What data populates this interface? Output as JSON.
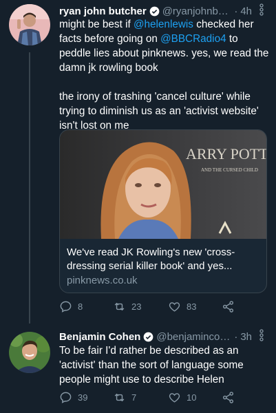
{
  "tweets": [
    {
      "name": "ryan john butcher",
      "handle": "@ryanjohnbut...",
      "time": "4h",
      "body": {
        "p1_a": "might be best if ",
        "mention1": "@helenlewis",
        "p1_b": " checked her facts before going on ",
        "mention2": "@BBCRadio4",
        "p1_c": " to peddle lies about pinknews. yes, we read the damn jk rowling book",
        "p2": "the irony of trashing 'cancel culture' while trying to diminish us as an 'activist website' isn't lost on me"
      },
      "card": {
        "image_text_line1": "ARRY POTTER",
        "image_text_line2": "AND THE CURSED CHILD",
        "title": "We've read JK Rowling's new 'cross-dressing serial killer book' and yes...",
        "domain": "pinknews.co.uk"
      },
      "actions": {
        "replies": "8",
        "retweets": "23",
        "likes": "83"
      }
    },
    {
      "name": "Benjamin Cohen",
      "handle": "@benjamincohen",
      "time": "3h",
      "body": "To be fair I'd rather be described as an 'activist' than the sort of language some people might use to describe Helen",
      "actions": {
        "replies": "39",
        "retweets": "7",
        "likes": "10"
      }
    }
  ],
  "colors": {
    "background": "#15202b",
    "accent": "#1da1f2",
    "muted": "#8899a6",
    "border": "#38444d"
  },
  "icons": [
    "reply-icon",
    "retweet-icon",
    "like-icon",
    "share-icon",
    "verified-icon",
    "caret-icon"
  ]
}
